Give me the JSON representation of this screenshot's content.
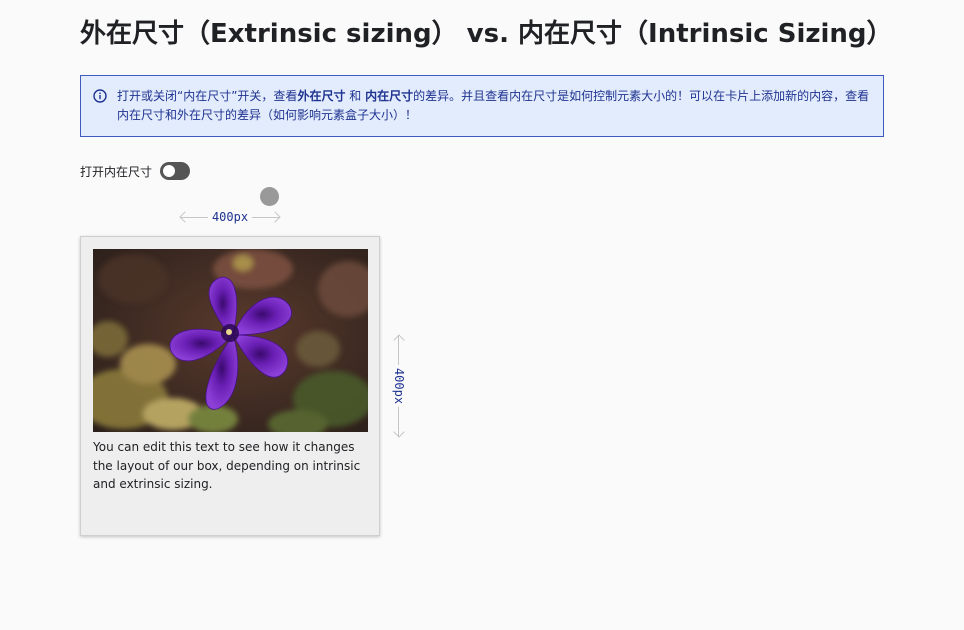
{
  "page": {
    "title": "外在尺寸（Extrinsic sizing） vs. 内在尺寸（Intrinsic Sizing）"
  },
  "info_banner": {
    "icon": "info-icon",
    "text_pre": "打开或关闭“内在尺寸”开关，查看",
    "text_bold1": "外在尺寸",
    "text_mid": " 和 ",
    "text_bold2": "内在尺寸",
    "text_post": "的差异。并且查看内在尺寸是如何控制元素大小的！可以在卡片上添加新的内容，查看内在尺寸和外在尺寸的差异（如何影响元素盒子大小）！"
  },
  "toggle": {
    "label": "打开内在尺寸",
    "on": false
  },
  "dimensions": {
    "width_label": "400px",
    "height_label": "400px"
  },
  "card": {
    "image_alt": "purple petunia flower",
    "text": "You can edit this text to see how it changes the layout of our box, depending on intrinsic and extrinsic sizing."
  },
  "colors": {
    "banner_background": "#e3ecfc",
    "banner_border": "#3d5abc",
    "banner_text": "#1f3391",
    "toggle_off": "#555555",
    "flower": "#6a1fb5"
  }
}
